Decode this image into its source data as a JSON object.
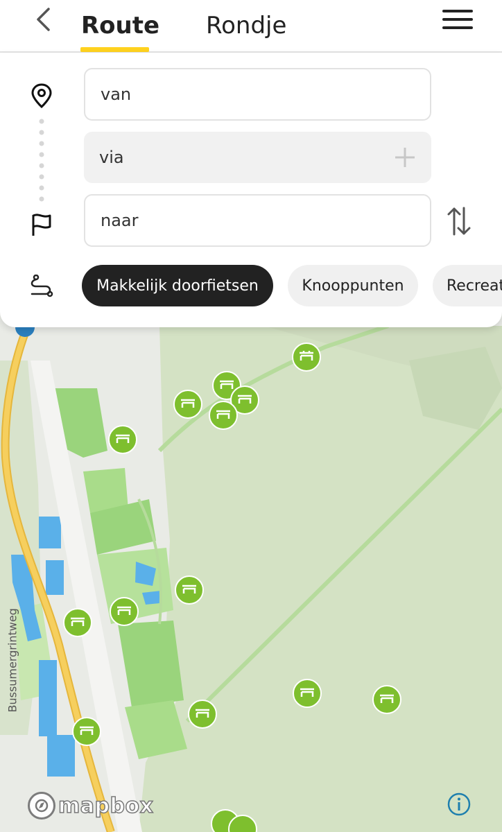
{
  "header": {
    "back_icon": "chevron-left-icon",
    "tabs": [
      {
        "label": "Route",
        "active": true
      },
      {
        "label": "Rondje",
        "active": false
      }
    ],
    "menu_icon": "hamburger-menu-icon",
    "accent_color": "#ffd21f"
  },
  "planner": {
    "from_placeholder": "van",
    "via_placeholder": "via",
    "to_placeholder": "naar",
    "start_icon": "location-pin-icon",
    "end_icon": "flag-icon",
    "add_icon": "plus-icon",
    "swap_icon": "swap-vertical-icon"
  },
  "profiles": {
    "icon": "route-icon",
    "chips": [
      {
        "label": "Makkelijk doorfietsen",
        "active": true
      },
      {
        "label": "Knooppunten",
        "active": false
      },
      {
        "label": "Recreat",
        "active": false
      }
    ]
  },
  "map": {
    "road_label": "Bussumergrintweg",
    "attribution": "mapbox",
    "info_icon": "info-icon",
    "marker_icon": "picnic-bench-icon",
    "colors": {
      "forest": "#d4e2c4",
      "park": "#9ad47c",
      "water": "#5ab0e9",
      "road": "#f3c24f",
      "marker": "#7ebf2e"
    }
  }
}
